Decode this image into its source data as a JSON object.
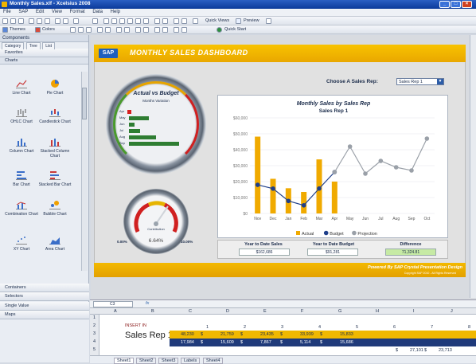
{
  "window": {
    "title": "Monthly Sales.xlf - Xcelsius 2008"
  },
  "menu": [
    "File",
    "SAP",
    "Edit",
    "View",
    "Format",
    "Data",
    "Help"
  ],
  "toolbar": {
    "quick_views": "Quick Views",
    "preview": "Preview",
    "themes": "Themes",
    "colors": "Colors",
    "quick_start": "Quick Start"
  },
  "components": {
    "header": "Components",
    "tabs": [
      "Category",
      "Tree",
      "List"
    ],
    "favorites": "Favorites",
    "charts_header": "Charts",
    "items": [
      "Line Chart",
      "Pie Chart",
      "OHLC Chart",
      "Candlestick Chart",
      "Column Chart",
      "Stacked Column Chart",
      "Bar Chart",
      "Stacked Bar Chart",
      "Combination Chart",
      "Bubble Chart",
      "XY Chart",
      "Area Chart"
    ],
    "sections": [
      "Containers",
      "Selectors",
      "Single Value",
      "Maps"
    ]
  },
  "dashboard": {
    "banner_sap": "SAP",
    "title": "MONTHLY SALES DASHBOARD",
    "rep_label": "Choose A Sales Rep:",
    "rep_value": "Sales Rep 1",
    "footer": "Powered By SAP Crystal Presentation Design",
    "footer_small": "Copyright SAP 2010 - All Rights Reserved",
    "gauge_title": "Actual vs Budget",
    "gauge_sub": "Months Variation",
    "dial_label": "Contribution",
    "dial_value": "6.64%",
    "dial_min": "0.00%",
    "dial_max": "10.00%",
    "ytd_sales_label": "Year to Date Sales",
    "ytd_sales": "$162,686",
    "ytd_budget_label": "Year to Date Budget",
    "ytd_budget": "$91,281",
    "difference_label": "Difference",
    "difference": "71,324.81"
  },
  "gauge_bars": [
    {
      "label": "Apr",
      "value": 0.0,
      "color": "#d62020"
    },
    {
      "label": "May",
      "value": 0.35,
      "color": "#2e7d32"
    },
    {
      "label": "Jun",
      "value": 0.1,
      "color": "#2e7d32"
    },
    {
      "label": "Jul",
      "value": 0.2,
      "color": "#2e7d32"
    },
    {
      "label": "Aug",
      "value": 0.48,
      "color": "#2e7d32"
    },
    {
      "label": "Sep",
      "value": 0.9,
      "color": "#2e7d32"
    }
  ],
  "chart_data": {
    "type": "bar",
    "title": "Monthly Sales by Sales Rep",
    "subtitle": "Sales Rep 1",
    "categories": [
      "Nov",
      "Dec",
      "Jan",
      "Feb",
      "Mar",
      "Apr",
      "May",
      "Jun",
      "Jul",
      "Aug",
      "Sep",
      "Oct"
    ],
    "series": [
      {
        "name": "Actual",
        "type": "bar",
        "color": "#f0aa00",
        "values": [
          48230,
          21759,
          15835,
          13500,
          33939,
          20000,
          null,
          null,
          null,
          null,
          null,
          null
        ]
      },
      {
        "name": "Budget",
        "type": "line",
        "color": "#1f3f8a",
        "values": [
          17984,
          15609,
          7867,
          5114,
          15686,
          26000,
          null,
          null,
          null,
          null,
          null,
          null
        ]
      },
      {
        "name": "Projection",
        "type": "line",
        "color": "#9aa0a8",
        "values": [
          null,
          null,
          null,
          null,
          null,
          26000,
          42000,
          25000,
          33000,
          29000,
          27000,
          47000
        ]
      }
    ],
    "yticks": [
      "$0",
      "$10,000",
      "$20,000",
      "$30,000",
      "$40,000",
      "$50,000",
      "$60,000"
    ],
    "ylim": [
      0,
      60000
    ],
    "legend_position": "bottom"
  },
  "spreadsheet": {
    "namebox": "C3",
    "cols": [
      "A",
      "B",
      "C",
      "D",
      "E",
      "F",
      "G",
      "H",
      "I",
      "J"
    ],
    "insert": "INSERT IN",
    "rep": "Sales Rep 1",
    "row2": [
      "1",
      "2",
      "3",
      "4",
      "5",
      "6",
      "7",
      "8"
    ],
    "row3": [
      "48,230",
      "$",
      "21,759",
      "$",
      "23,435",
      "$",
      "33,939",
      "$",
      "15,833"
    ],
    "row4": [
      "17,984",
      "$",
      "15,609",
      "$",
      "7,867",
      "$",
      "5,114",
      "$",
      "15,686"
    ],
    "row5": [
      "$",
      "27,101",
      "$",
      "23,713"
    ],
    "sheets": [
      "Sheet1",
      "Sheet2",
      "Sheet3",
      "Labels",
      "Sheet4"
    ]
  }
}
